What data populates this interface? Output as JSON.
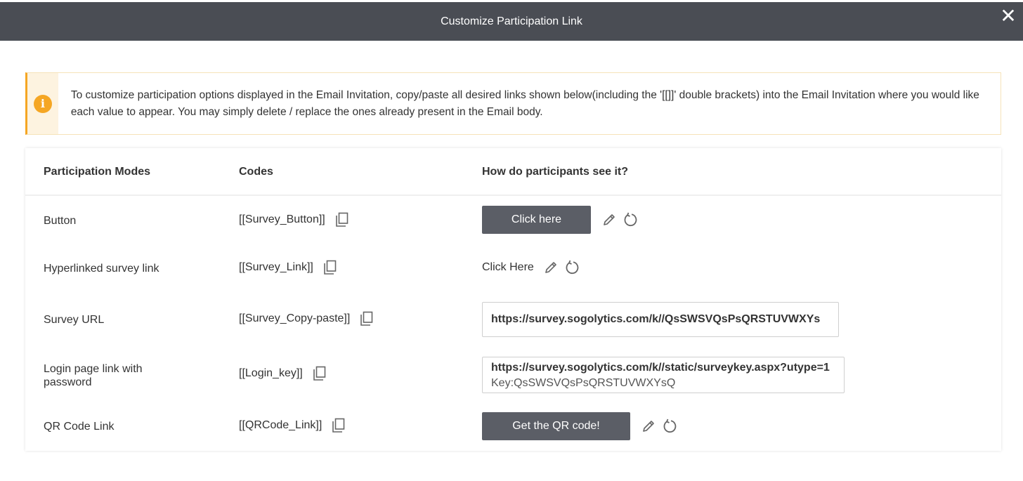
{
  "dialog": {
    "title": "Customize Participation Link",
    "close_glyph": "✕"
  },
  "notice": {
    "icon_glyph": "i",
    "text": "To customize participation options displayed in the Email Invitation, copy/paste all desired links shown below(including the '[[]]' double brackets) into the Email Invitation where you would like each value to appear. You may simply delete / replace the ones already present in the Email body."
  },
  "table": {
    "headers": {
      "modes": "Participation Modes",
      "codes": "Codes",
      "preview": "How do participants see it?"
    },
    "rows": [
      {
        "mode": "Button",
        "code": "[[Survey_Button]]",
        "preview_label": "Click here"
      },
      {
        "mode": "Hyperlinked survey link",
        "code": "[[Survey_Link]]",
        "preview_label": "Click Here"
      },
      {
        "mode": "Survey URL",
        "code": "[[Survey_Copy-paste]]",
        "preview_label": "https://survey.sogolytics.com/k//QsSWSVQsPsQRSTUVWXYs"
      },
      {
        "mode": "Login page link with password",
        "code": "[[Login_key]]",
        "preview_label": "https://survey.sogolytics.com/k//static/surveykey.aspx?utype=1",
        "preview_label_2": "Key:QsSWSVQsPsQRSTUVWXYsQ"
      },
      {
        "mode": "QR Code Link",
        "code": "[[QRCode_Link]]",
        "preview_label": "Get the QR code!"
      }
    ]
  },
  "colors": {
    "header_bg": "#4a4d54",
    "accent_warning": "#f5a623",
    "button_bg": "#5b5e66"
  },
  "icons": {
    "copy": "copy-icon",
    "edit": "pencil-icon",
    "reset": "reset-icon",
    "info": "info-icon",
    "close": "close-icon"
  }
}
